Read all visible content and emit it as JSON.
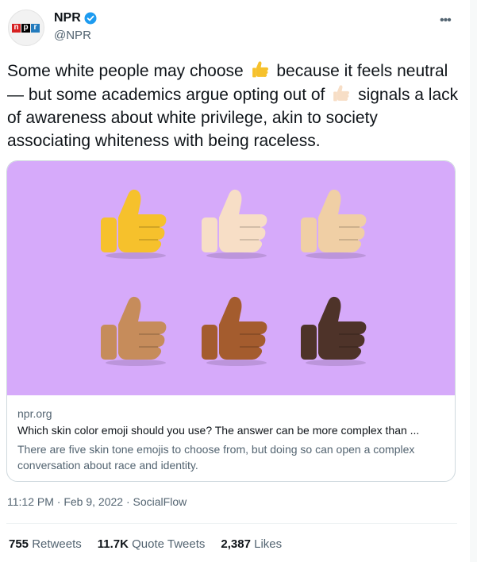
{
  "account": {
    "name": "NPR",
    "handle": "@NPR",
    "logo_letters": [
      "n",
      "p",
      "r"
    ]
  },
  "menu_glyph": "•••",
  "tweet": {
    "text_parts": [
      "Some white people may choose ",
      " because it feels neutral — but some academics argue opting out of ",
      " signals a lack of awareness about white privilege, akin to society associating whiteness with being raceless."
    ],
    "inline_emojis": [
      "thumbs-up-yellow",
      "thumbs-up-light-skin"
    ]
  },
  "card": {
    "image_background": "#d6aafa",
    "thumb_colors": [
      "#f6c12c",
      "#f7dec6",
      "#f0cfa5",
      "#c68c5b",
      "#a45c2e",
      "#4e3329"
    ],
    "domain": "npr.org",
    "title": "Which skin color emoji should you use? The answer can be more complex than ...",
    "description": "There are five skin tone emojis to choose from, but doing so can open a complex conversation about race and identity."
  },
  "meta": {
    "time": "11:12 PM",
    "date": "Feb 9, 2022",
    "source": "SocialFlow",
    "separator": "·"
  },
  "stats": {
    "retweets_count": "755",
    "retweets_label": "Retweets",
    "quotes_count": "11.7K",
    "quotes_label": "Quote Tweets",
    "likes_count": "2,387",
    "likes_label": "Likes"
  },
  "colors": {
    "verified": "#1d9bf0",
    "secondary_text": "#536471",
    "border": "#cfd9de"
  }
}
